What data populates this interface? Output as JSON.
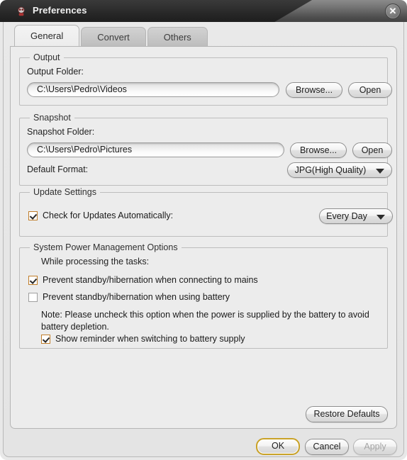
{
  "window": {
    "title": "Preferences",
    "icon": "app-icon",
    "close_label": "✕"
  },
  "tabs": [
    {
      "label": "General",
      "active": true
    },
    {
      "label": "Convert",
      "active": false
    },
    {
      "label": "Others",
      "active": false
    }
  ],
  "output": {
    "group_title": "Output",
    "folder_label": "Output Folder:",
    "folder_value": "C:\\Users\\Pedro\\Videos",
    "browse_label": "Browse...",
    "open_label": "Open"
  },
  "snapshot": {
    "group_title": "Snapshot",
    "folder_label": "Snapshot Folder:",
    "folder_value": "C:\\Users\\Pedro\\Pictures",
    "browse_label": "Browse...",
    "open_label": "Open",
    "format_label": "Default Format:",
    "format_value": "JPG(High Quality)"
  },
  "update": {
    "group_title": "Update Settings",
    "check_label": "Check for Updates Automatically:",
    "check_checked": true,
    "frequency_value": "Every Day"
  },
  "power": {
    "group_title": "System Power Management Options",
    "intro": "While processing the tasks:",
    "option_mains_label": "Prevent standby/hibernation when connecting to mains",
    "option_mains_checked": true,
    "option_battery_label": "Prevent standby/hibernation when using battery",
    "option_battery_checked": false,
    "note": "Note: Please uncheck this option when the power is supplied by the battery to avoid battery depletion.",
    "option_reminder_label": "Show reminder when switching to battery supply",
    "option_reminder_checked": true
  },
  "actions": {
    "restore_defaults_label": "Restore Defaults",
    "ok_label": "OK",
    "cancel_label": "Cancel",
    "apply_label": "Apply",
    "apply_disabled": true
  },
  "colors": {
    "accent_focus": "#c9a227",
    "checkbox_checked_border": "#c07d2a",
    "dialog_bg": "#ececec",
    "titlebar_dark": "#242424"
  }
}
